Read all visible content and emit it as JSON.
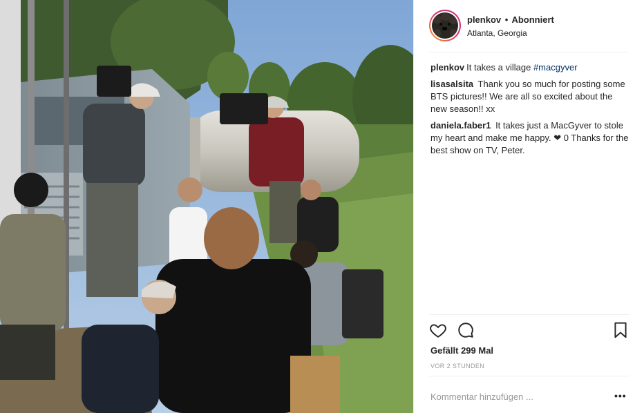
{
  "header": {
    "username": "plenkov",
    "separator": "•",
    "follow_status": "Abonniert",
    "location": "Atlanta, Georgia"
  },
  "comments": [
    {
      "user": "plenkov",
      "text": "It takes a village ",
      "hashtag": "#macgyver"
    },
    {
      "user": "lisasalsita",
      "text": "Thank you so much for posting some BTS pictures!! We are all so excited about the new season!! xx"
    },
    {
      "user": "daniela.faber1",
      "text": "It takes just a MacGyver to stole my heart and make me happy. ❤ 0 Thanks for the best show on TV, Peter."
    }
  ],
  "actions": {
    "likes": "Gefällt 299 Mal",
    "time": "VOR 2 STUNDEN"
  },
  "comment_box": {
    "placeholder": "Kommentar hinzufügen ...",
    "more": "•••"
  },
  "icons": {
    "like": "heart-icon",
    "comment": "comment-icon",
    "save": "bookmark-icon",
    "more": "more-icon"
  }
}
